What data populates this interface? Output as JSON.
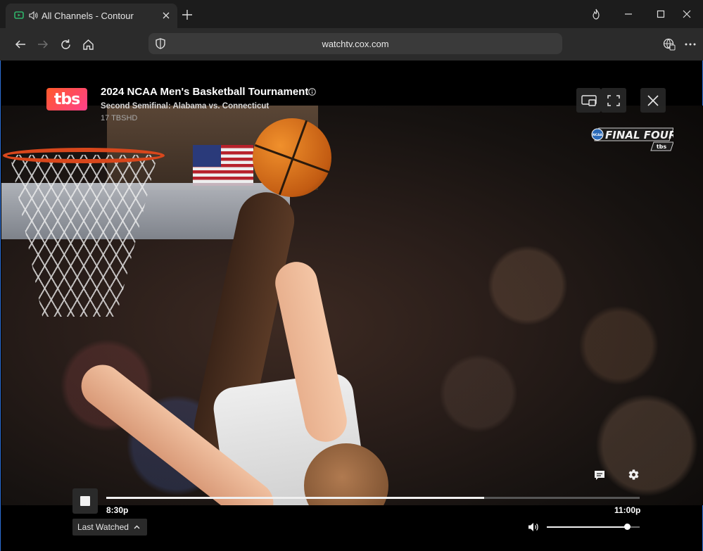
{
  "browser": {
    "tab_title": "All Channels - Contour",
    "address": "watchtv.cox.com"
  },
  "player": {
    "network_logo": "tbs",
    "show_title": "2024 NCAA Men's Basketball Tournament",
    "episode_title": "Second Semifinal: Alabama vs. Connecticut",
    "channel": "17 TBSHD",
    "broadcast_bug": {
      "badge": "NCAA",
      "text": "FINAL FOUR",
      "network": "tbs"
    },
    "start_time": "8:30p",
    "end_time": "11:00p",
    "progress_fraction": 0.708,
    "volume_fraction": 0.86,
    "last_watched_label": "Last Watched"
  },
  "colors": {
    "accent_border": "#2c6fd6",
    "tbs_gradient_start": "#ff5a2a",
    "tbs_gradient_end": "#ff3f8c"
  },
  "icons": [
    "tv-favicon-icon",
    "speaker-icon",
    "close-icon",
    "plus-icon",
    "flame-icon",
    "minimize-icon",
    "maximize-icon",
    "back-arrow-icon",
    "forward-arrow-icon",
    "refresh-icon",
    "home-icon",
    "shield-icon",
    "globe-icon",
    "more-icon",
    "info-icon",
    "picture-in-picture-icon",
    "fullscreen-icon",
    "close-player-icon",
    "captions-icon",
    "gear-icon",
    "stop-icon",
    "chevron-up-icon",
    "volume-icon"
  ]
}
